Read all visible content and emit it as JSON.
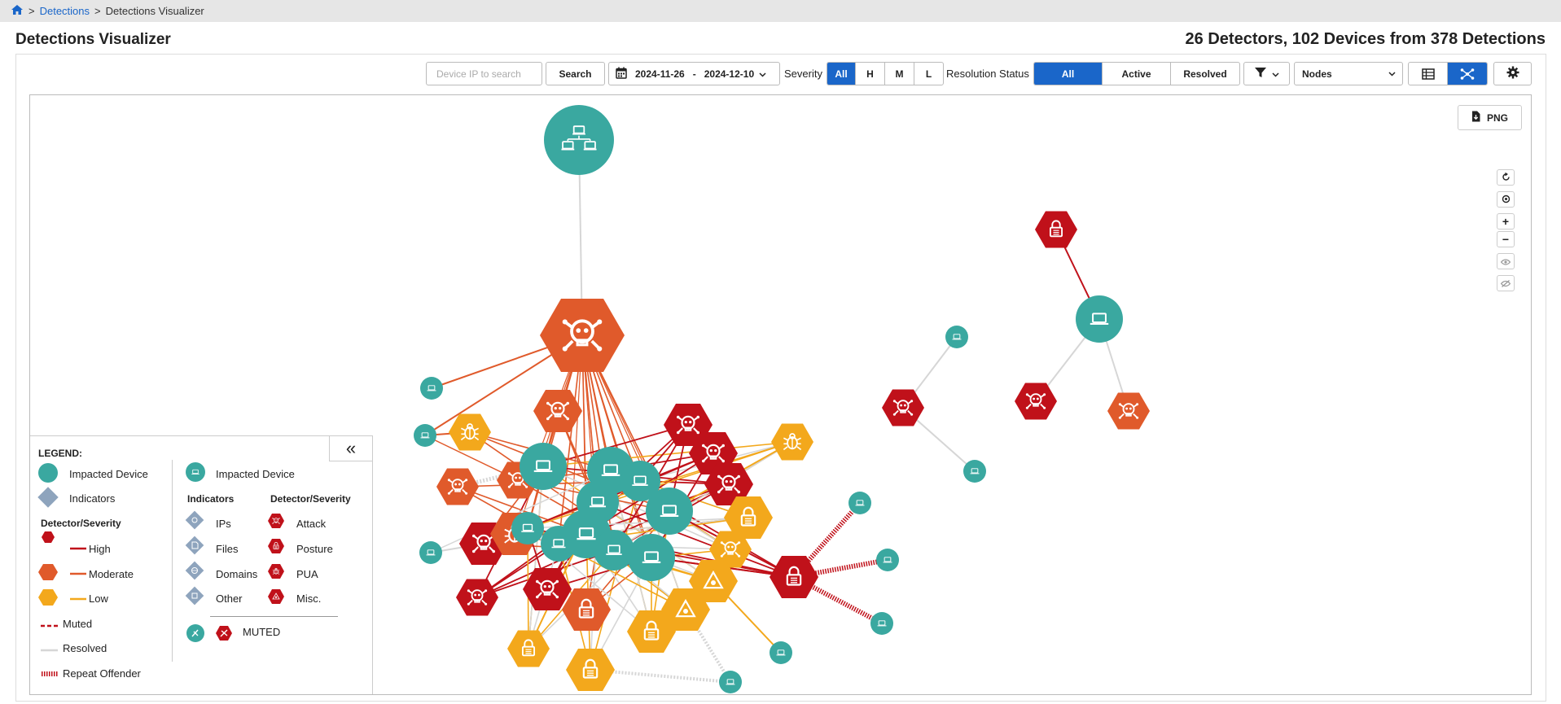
{
  "breadcrumb": {
    "home_icon": "home-icon",
    "separator": ">",
    "items": [
      "Detections",
      "Detections Visualizer"
    ]
  },
  "page": {
    "title": "Detections Visualizer",
    "summary": "26 Detectors, 102 Devices from 378 Detections"
  },
  "toolbar": {
    "search_placeholder": "Device IP to search",
    "search_label": "Search",
    "date_from": "2024-11-26",
    "date_sep": "-",
    "date_to": "2024-12-10",
    "severity_label": "Severity",
    "severity_options": [
      "All",
      "H",
      "M",
      "L"
    ],
    "severity_selected": "All",
    "resolution_label": "Resolution Status",
    "resolution_options": [
      "All",
      "Active",
      "Resolved"
    ],
    "resolution_selected": "All",
    "view_select": "Nodes",
    "icons": {
      "filter": "filter-icon",
      "table_view": "table-icon",
      "graph_view": "network-icon",
      "settings": "gear-icon",
      "calendar": "calendar-icon"
    }
  },
  "viz": {
    "png_label": "PNG",
    "controls": [
      "reset-icon",
      "target-icon",
      "+",
      "−",
      "eye-icon",
      "eye-off-icon"
    ]
  },
  "legend": {
    "title": "LEGEND:",
    "impacted_device": "Impacted Device",
    "indicators": "Indicators",
    "detector_severity": "Detector/Severity",
    "severities": [
      "High",
      "Moderate",
      "Low"
    ],
    "muted": "Muted",
    "resolved": "Resolved",
    "repeat_offender": "Repeat Offender",
    "impacted_device_small": "Impacted Device",
    "indicators_header": "Indicators",
    "detector_header": "Detector/Severity",
    "indicator_types": [
      "IPs",
      "Files",
      "Domains",
      "Other"
    ],
    "detector_types": [
      "Attack",
      "Posture",
      "PUA",
      "Misc."
    ],
    "muted_label": "MUTED",
    "collapse_symbol": "«"
  },
  "colors": {
    "high": "#c0111a",
    "moderate": "#e05a2b",
    "low": "#f3a81c",
    "device": "#3aa8a0",
    "indicator": "#8ea4bd",
    "resolved": "#d6d6d6",
    "accent": "#1a66c9"
  },
  "graph": {
    "nodes": [
      {
        "id": "hub",
        "kind": "device-group",
        "type": "device"
      },
      {
        "id": "d1",
        "kind": "attack",
        "type": "moderate"
      },
      {
        "id": "dr_lock",
        "kind": "posture",
        "type": "high"
      },
      {
        "id": "dr_dev",
        "kind": "device",
        "type": "device"
      },
      {
        "id": "dr_a1",
        "kind": "attack",
        "type": "high"
      },
      {
        "id": "dr_a2",
        "kind": "attack",
        "type": "moderate"
      },
      {
        "id": "dm_dev1",
        "kind": "device",
        "type": "device"
      },
      {
        "id": "dm_att",
        "kind": "attack",
        "type": "high"
      },
      {
        "id": "dm_dev2",
        "kind": "device",
        "type": "device"
      },
      {
        "id": "c_dev1",
        "kind": "device",
        "type": "device"
      },
      {
        "id": "c_dev2",
        "kind": "device",
        "type": "device"
      },
      {
        "id": "c_dev3",
        "kind": "device",
        "type": "device"
      },
      {
        "id": "c_bug1",
        "kind": "bug",
        "type": "low"
      },
      {
        "id": "c_att1",
        "kind": "attack",
        "type": "moderate"
      },
      {
        "id": "c_att2",
        "kind": "attack",
        "type": "moderate"
      },
      {
        "id": "c_att3",
        "kind": "attack",
        "type": "moderate"
      },
      {
        "id": "c_att4",
        "kind": "attack",
        "type": "high"
      },
      {
        "id": "c_bug2",
        "kind": "bug",
        "type": "moderate"
      },
      {
        "id": "c_att5",
        "kind": "attack",
        "type": "high"
      },
      {
        "id": "c_att6",
        "kind": "attack",
        "type": "high"
      },
      {
        "id": "c_att7",
        "kind": "attack",
        "type": "high"
      },
      {
        "id": "c_att8",
        "kind": "attack",
        "type": "high"
      },
      {
        "id": "c_att9",
        "kind": "attack",
        "type": "high"
      },
      {
        "id": "c_bug3",
        "kind": "bug",
        "type": "low"
      },
      {
        "id": "c_lock1",
        "kind": "posture",
        "type": "low"
      },
      {
        "id": "c_att10",
        "kind": "attack",
        "type": "low"
      },
      {
        "id": "c_warn1",
        "kind": "misc",
        "type": "low"
      },
      {
        "id": "c_warn2",
        "kind": "misc",
        "type": "low"
      },
      {
        "id": "c_lock2",
        "kind": "posture",
        "type": "moderate"
      },
      {
        "id": "c_lock3",
        "kind": "posture",
        "type": "low"
      },
      {
        "id": "c_lock4",
        "kind": "posture",
        "type": "low"
      },
      {
        "id": "c_lock5",
        "kind": "posture",
        "type": "low"
      },
      {
        "id": "c_lockR",
        "kind": "posture",
        "type": "high"
      },
      {
        "id": "c_dev4",
        "kind": "device",
        "type": "device"
      },
      {
        "id": "c_dev5",
        "kind": "device",
        "type": "device"
      },
      {
        "id": "c_dev6",
        "kind": "device",
        "type": "device"
      },
      {
        "id": "c_dev7",
        "kind": "device",
        "type": "device"
      },
      {
        "id": "c_dev8",
        "kind": "device",
        "type": "device"
      },
      {
        "id": "c_dev9",
        "kind": "device",
        "type": "device"
      },
      {
        "id": "b_dev1",
        "kind": "device",
        "type": "device"
      },
      {
        "id": "b_dev2",
        "kind": "device",
        "type": "device"
      },
      {
        "id": "b_dev3",
        "kind": "device",
        "type": "device"
      },
      {
        "id": "b_dev4",
        "kind": "device",
        "type": "device"
      },
      {
        "id": "b_dev5",
        "kind": "device",
        "type": "device"
      },
      {
        "id": "b_dev6",
        "kind": "device",
        "type": "device"
      },
      {
        "id": "b_dev7",
        "kind": "device",
        "type": "device"
      },
      {
        "id": "b_dev8",
        "kind": "device",
        "type": "device"
      },
      {
        "id": "b_dev9",
        "kind": "device",
        "type": "device"
      }
    ]
  }
}
